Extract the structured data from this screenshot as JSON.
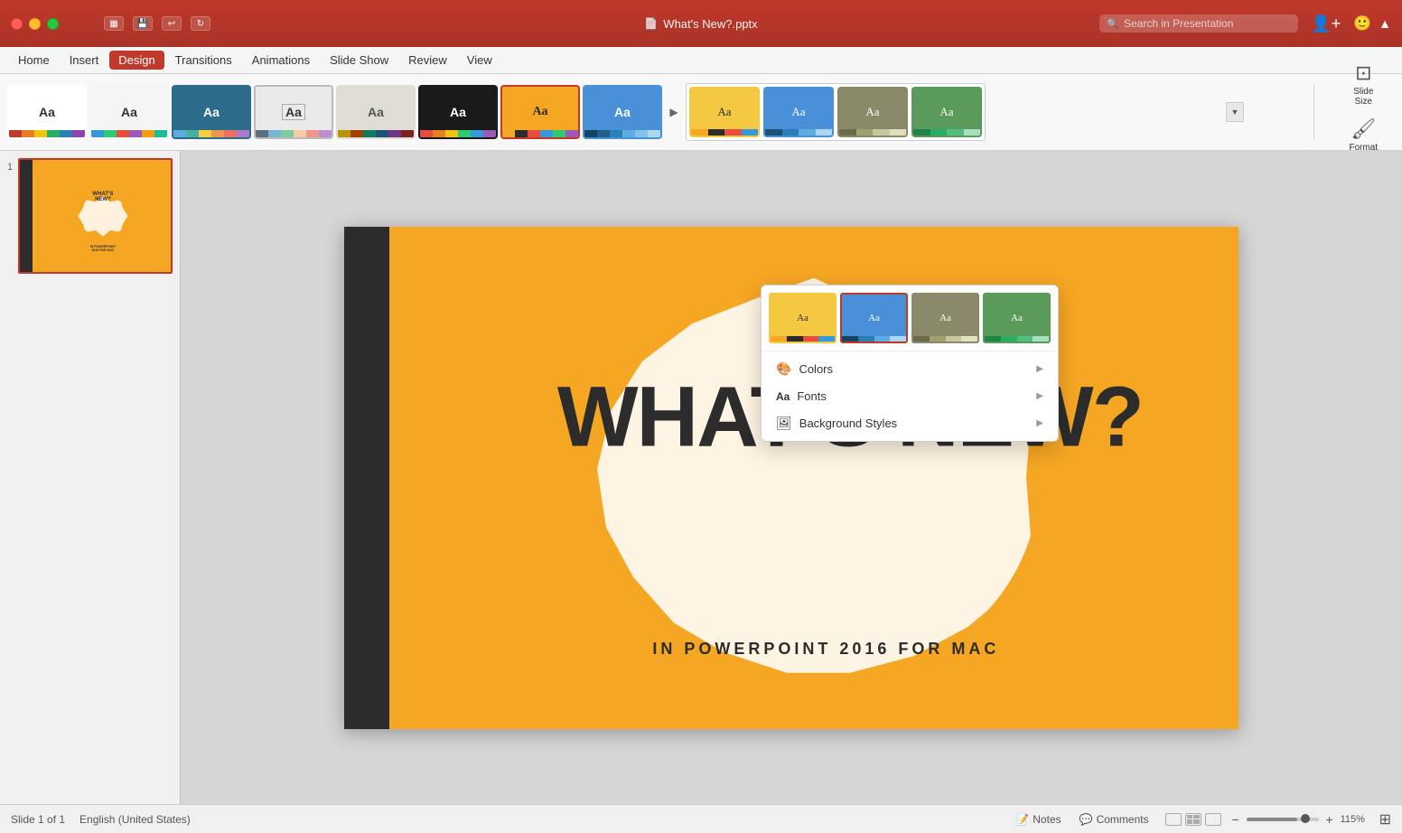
{
  "titlebar": {
    "filename": "What's New?.pptx",
    "search_placeholder": "Search in Presentation",
    "traffic": {
      "close": "close",
      "minimize": "minimize",
      "maximize": "maximize"
    }
  },
  "menubar": {
    "items": [
      {
        "id": "home",
        "label": "Home"
      },
      {
        "id": "insert",
        "label": "Insert"
      },
      {
        "id": "design",
        "label": "Design",
        "active": true
      },
      {
        "id": "transitions",
        "label": "Transitions"
      },
      {
        "id": "animations",
        "label": "Animations"
      },
      {
        "id": "slideshow",
        "label": "Slide Show"
      },
      {
        "id": "review",
        "label": "Review"
      },
      {
        "id": "view",
        "label": "View"
      }
    ]
  },
  "ribbon": {
    "themes": [
      {
        "id": 1,
        "label": "Aa",
        "bg": "#ffffff",
        "selected": false
      },
      {
        "id": 2,
        "label": "Aa",
        "bg": "#f5f5f5",
        "selected": false
      },
      {
        "id": 3,
        "label": "Aa",
        "bg": "#2d6b8a",
        "selected": false
      },
      {
        "id": 4,
        "label": "Aa",
        "bg": "#eaeaea",
        "selected": false
      },
      {
        "id": 5,
        "label": "Aa",
        "bg": "#e0e0d0",
        "selected": false
      },
      {
        "id": 6,
        "label": "Aa",
        "bg": "#111111",
        "selected": false
      },
      {
        "id": 7,
        "label": "Aa",
        "bg": "#f5a623",
        "selected": true
      },
      {
        "id": 8,
        "label": "Aa",
        "bg": "#4a90d9",
        "selected": false
      }
    ],
    "slide_size_label": "Slide\nSize",
    "format_background_label": "Format\nBackground"
  },
  "dropdown": {
    "themes": [
      {
        "id": 1,
        "bg": "#f5c842",
        "selected": false
      },
      {
        "id": 2,
        "bg": "#4a90d9",
        "selected": true
      },
      {
        "id": 3,
        "bg": "#8a8a6a",
        "selected": false
      },
      {
        "id": 4,
        "bg": "#5a9a5a",
        "selected": false
      }
    ],
    "items": [
      {
        "id": "colors",
        "icon": "🎨",
        "label": "Colors"
      },
      {
        "id": "fonts",
        "icon": "Aa",
        "label": "Fonts"
      },
      {
        "id": "background-styles",
        "icon": "🖼",
        "label": "Background Styles"
      }
    ]
  },
  "slide": {
    "main_text": "WHAT'S NEW?",
    "sub_text": "IN POWERPOINT 2016 FOR MAC"
  },
  "statusbar": {
    "slide_info": "Slide 1 of 1",
    "language": "English (United States)",
    "notes_label": "Notes",
    "comments_label": "Comments",
    "zoom_value": "115%",
    "zoom_minus": "−",
    "zoom_plus": "+"
  }
}
